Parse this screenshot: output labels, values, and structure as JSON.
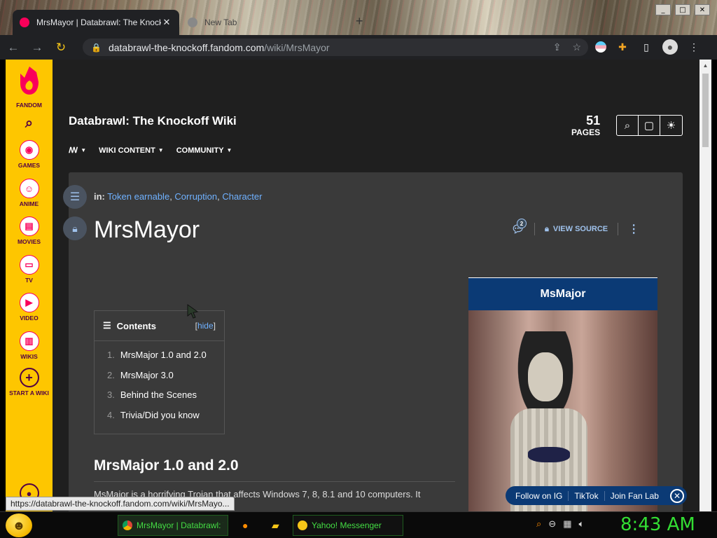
{
  "browser": {
    "active_tab_title": "MrsMayor | Databrawl: The Knockoff Wiki",
    "inactive_tab_title": "New Tab",
    "tab_close": "✕",
    "new_tab": "+",
    "url_host": "databrawl-the-knockoff.fandom.com",
    "url_path": "/wiki/MrsMayor",
    "window_controls": [
      "_",
      "□",
      "✕"
    ]
  },
  "rail": {
    "brand": "FANDOM",
    "items": [
      {
        "label": "GAMES",
        "icon": "gamepad-icon"
      },
      {
        "label": "ANIME",
        "icon": "anime-face-icon"
      },
      {
        "label": "MOVIES",
        "icon": "clapper-icon"
      },
      {
        "label": "TV",
        "icon": "tv-icon"
      },
      {
        "label": "VIDEO",
        "icon": "play-icon"
      },
      {
        "label": "WIKIS",
        "icon": "book-icon"
      },
      {
        "label": "START A WIKI",
        "icon": "plus-circle-icon"
      }
    ]
  },
  "wiki": {
    "title": "Databrawl: The Knockoff Wiki",
    "pages_count": "51",
    "pages_label": "PAGES",
    "nav": [
      "WIKI CONTENT",
      "COMMUNITY"
    ]
  },
  "article": {
    "categories_label": "in:",
    "categories": [
      "Token earnable",
      "Corruption",
      "Character"
    ],
    "title": "MrsMayor",
    "comment_count": "2",
    "view_source": "VIEW SOURCE",
    "toc": {
      "heading": "Contents",
      "hide_open": "[",
      "hide_label": "hide",
      "hide_close": "]",
      "items": [
        {
          "n": "1.",
          "label": "MrsMajor 1.0 and 2.0"
        },
        {
          "n": "2.",
          "label": "MrsMajor 3.0"
        },
        {
          "n": "3.",
          "label": "Behind the Scenes"
        },
        {
          "n": "4.",
          "label": "Trivia/Did you know"
        }
      ]
    },
    "section_heading": "MrsMajor 1.0 and 2.0",
    "body_text": "MsMajor is a horrifying Trojan that affects Windows 7, 8, 8.1 and 10 computers. It"
  },
  "infobox": {
    "title": "MsMajor"
  },
  "social": [
    "Follow on IG",
    "TikTok",
    "Join Fan Lab"
  ],
  "status_link": "https://databrawl-the-knockoff.fandom.com/wiki/MrsMayo...",
  "taskbar": {
    "chrome_task": "MrsMayor | Databrawl: The Knockoff Wiki",
    "yahoo_task": "Yahoo! Messenger",
    "clock": "8:43 AM"
  }
}
